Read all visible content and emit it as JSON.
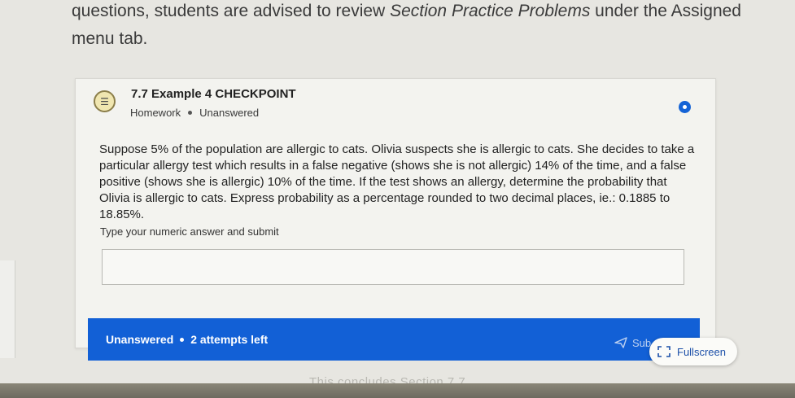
{
  "intro": {
    "line1_prefix": "questions, students are advised to review ",
    "line1_link": "Section Practice Problems",
    "line1_suffix": " under the Assigned",
    "line2": "menu tab."
  },
  "card": {
    "icon": "list-icon",
    "title": "7.7 Example 4 CHECKPOINT",
    "type": "Homework",
    "status": "Unanswered",
    "question": "Suppose 5% of the population are allergic to cats. Olivia suspects she is allergic to cats. She decides to take a particular allergy test which results in a false negative (shows she is not allergic) 14% of the time, and a false positive (shows she is allergic) 10% of the time. If the test shows an allergy, determine the probability that Olivia is allergic to cats. Express probability as a percentage rounded to two decimal places, ie.: 0.1885 to 18.85%.",
    "prompt": "Type your numeric answer and submit",
    "answer_value": ""
  },
  "bar": {
    "status": "Unanswered",
    "attempts": "2 attempts left",
    "submit_label": "Sub",
    "submit_icon": "send-icon"
  },
  "fullscreen": {
    "label": "Fullscreen",
    "icon": "expand-icon"
  },
  "footer": {
    "text": "This concludes Section 7.7"
  },
  "colors": {
    "accent": "#1260d6",
    "background": "#e7e6e1"
  }
}
